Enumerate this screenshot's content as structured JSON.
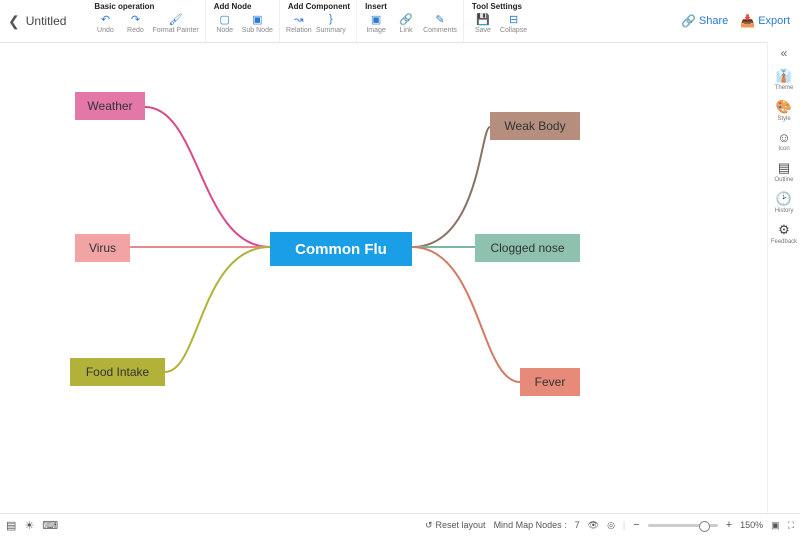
{
  "doc_title": "Untitled",
  "ribbon": {
    "basic": {
      "title": "Basic operation",
      "undo": "Undo",
      "redo": "Redo",
      "format": "Format Painter"
    },
    "addnode": {
      "title": "Add Node",
      "node": "Node",
      "subnode": "Sub Node"
    },
    "addcomp": {
      "title": "Add Component",
      "relation": "Relation",
      "summary": "Summary"
    },
    "insert": {
      "title": "Insert",
      "image": "Image",
      "link": "Link",
      "comments": "Comments"
    },
    "tool": {
      "title": "Tool Settings",
      "save": "Save",
      "collapse": "Collapse"
    }
  },
  "top_right": {
    "share": "Share",
    "export": "Export"
  },
  "right_panel": {
    "theme": "Theme",
    "style": "Style",
    "icon": "Icon",
    "outline": "Outline",
    "history": "History",
    "feedback": "Feedback"
  },
  "mindmap": {
    "center": "Common Flu",
    "nodes": {
      "weather": "Weather",
      "virus": "Virus",
      "food": "Food Intake",
      "weak": "Weak Body",
      "clogged": "Clogged nose",
      "fever": "Fever"
    }
  },
  "bottom": {
    "reset": "Reset layout",
    "nodes_label": "Mind Map Nodes :",
    "nodes_count": "7",
    "zoom": "150%"
  }
}
